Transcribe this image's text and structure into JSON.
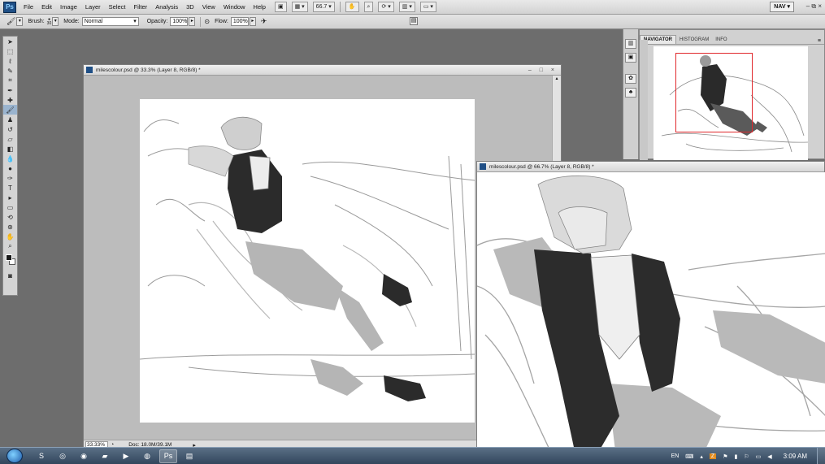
{
  "menubar": {
    "logo": "Ps",
    "items": [
      "File",
      "Edit",
      "Image",
      "Layer",
      "Select",
      "Filter",
      "Analysis",
      "3D",
      "View",
      "Window",
      "Help"
    ],
    "zoom_value": "66.7",
    "workspace": "NAV",
    "window_controls": "– ⧉ ×"
  },
  "options": {
    "brush_label": "Brush:",
    "brush_size": "30",
    "mode_label": "Mode:",
    "mode_value": "Normal",
    "opacity_label": "Opacity:",
    "opacity_value": "100%",
    "flow_label": "Flow:",
    "flow_value": "100%"
  },
  "navigator": {
    "tabs": [
      "NAVIGATOR",
      "HISTOGRAM",
      "INFO"
    ]
  },
  "doc1": {
    "title": "milescolour.psd @ 33.3% (Layer 8, RGB/8) *",
    "zoom": "33.33%",
    "doc_info": "Doc: 18.0M/39.1M",
    "controls": "– □ ×"
  },
  "doc2": {
    "title": "milescolour.psd @ 66.7% (Layer 8, RGB/8) *"
  },
  "taskbar": {
    "language": "EN",
    "clock": "3:09 AM"
  }
}
